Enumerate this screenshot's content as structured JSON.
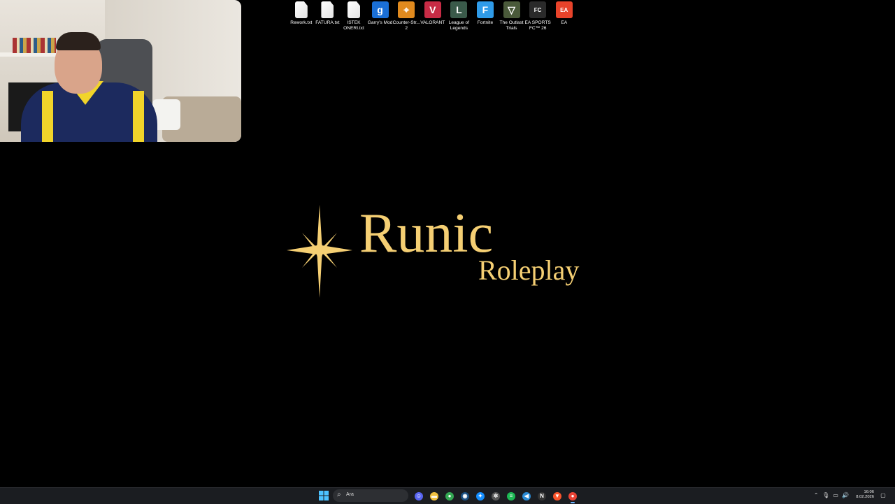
{
  "desktop": {
    "icons": [
      {
        "label": "Rework.txt",
        "icon": "text-file-icon",
        "color": "#ffffff"
      },
      {
        "label": "FATURA.txt",
        "icon": "text-file-icon",
        "color": "#ffffff"
      },
      {
        "label": "ISTEK ONERI.txt",
        "icon": "text-file-icon",
        "color": "#ffffff"
      },
      {
        "label": "Garry's Mod",
        "icon": "garrys-mod-icon",
        "glyph": "g",
        "color": "#1a6fd6"
      },
      {
        "label": "Counter-Str... 2",
        "icon": "counter-strike-icon",
        "glyph": "⌖",
        "color": "#e08a1e"
      },
      {
        "label": "VALORANT",
        "icon": "valorant-icon",
        "glyph": "V",
        "color": "#c72b45"
      },
      {
        "label": "League of Legends",
        "icon": "league-of-legends-icon",
        "glyph": "L",
        "color": "#3a5a4a"
      },
      {
        "label": "Fortnite",
        "icon": "fortnite-icon",
        "glyph": "F",
        "color": "#2f9be8"
      },
      {
        "label": "The Outlast Trials",
        "icon": "outlast-trials-icon",
        "glyph": "▽",
        "color": "#4a5a3a"
      },
      {
        "label": "EA SPORTS FC™ 26",
        "icon": "ea-sports-fc-icon",
        "glyph": "FC",
        "color": "#2a2a2a"
      },
      {
        "label": "EA",
        "icon": "ea-icon",
        "glyph": "EA",
        "color": "#e8432a"
      }
    ]
  },
  "logo": {
    "title": "Runic",
    "subtitle": "Roleplay",
    "color": "#f5cf73"
  },
  "taskbar": {
    "search_placeholder": "Ara",
    "apps": [
      {
        "name": "discord-icon",
        "glyph": "☺",
        "color": "#5865f2",
        "active": false
      },
      {
        "name": "file-explorer-icon",
        "glyph": "▬",
        "color": "#f0c040",
        "active": false
      },
      {
        "name": "chrome-icon",
        "glyph": "●",
        "color": "#34a853",
        "active": false
      },
      {
        "name": "steam-icon",
        "glyph": "◉",
        "color": "#1b4f80",
        "active": false
      },
      {
        "name": "battlenet-icon",
        "glyph": "✦",
        "color": "#148eff",
        "active": false
      },
      {
        "name": "openai-icon",
        "glyph": "✲",
        "color": "#555555",
        "active": false
      },
      {
        "name": "spotify-icon",
        "glyph": "≡",
        "color": "#1db954",
        "active": false
      },
      {
        "name": "vscode-icon",
        "glyph": "◀",
        "color": "#2a8ad4",
        "active": false
      },
      {
        "name": "notion-icon",
        "glyph": "N",
        "color": "#333333",
        "active": false
      },
      {
        "name": "brave-icon",
        "glyph": "▼",
        "color": "#fb542b",
        "active": false
      },
      {
        "name": "chrome-active-icon",
        "glyph": "●",
        "color": "#ea4335",
        "active": true
      }
    ],
    "clock": {
      "time": "16:06",
      "date": "8.02.2026"
    }
  }
}
